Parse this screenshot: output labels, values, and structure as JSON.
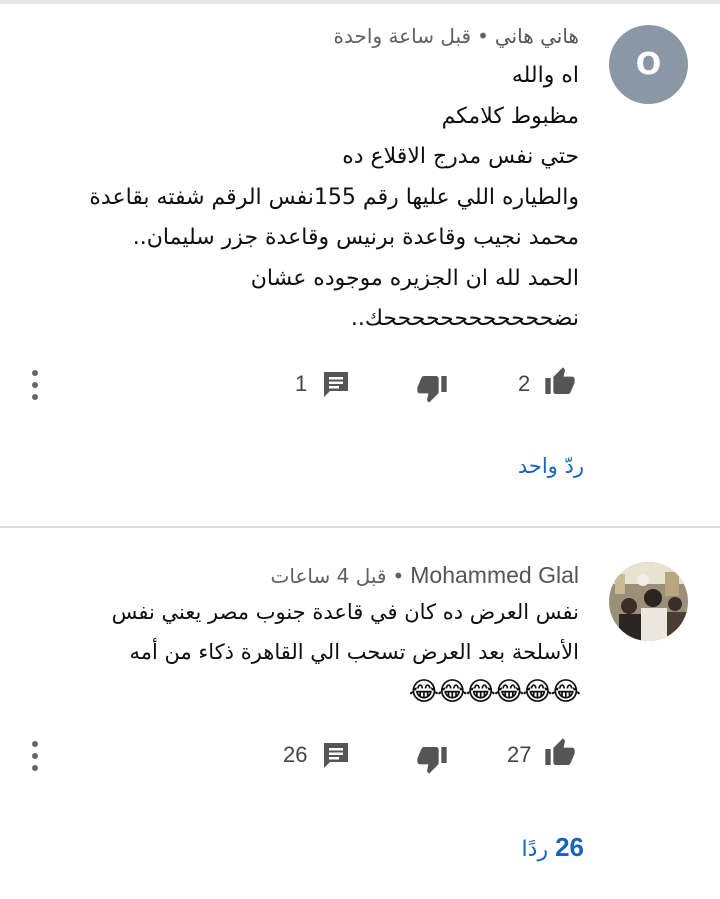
{
  "comments": [
    {
      "author": "هاني هاني",
      "time": "قبل ساعة واحدة",
      "avatar_letter": "O",
      "lines": [
        "اه والله",
        "مظبوط كلامكم",
        "حتي نفس مدرج الاقلاع ده",
        "والطياره اللي عليها رقم 155نفس الرقم شفته بقاعدة",
        "محمد نجيب وقاعدة برنيس وقاعدة جزر سليمان..",
        "الحمد لله ان الجزيره موجوده عشان",
        "نضححححححححححححك.."
      ],
      "likes": "2",
      "replies_count": "1",
      "reply_link": "ردّ واحد"
    },
    {
      "author": "Mohammed Glal",
      "time": "قبل 4 ساعات",
      "lines": [
        "نفس العرض ده كان في قاعدة جنوب مصر يعني نفس",
        "الأسلحة بعد العرض تسحب الي القاهرة ذكاء من أمه",
        "😂😂😂😂😂😂"
      ],
      "likes": "27",
      "replies_count": "26",
      "reply_count_num": "26",
      "reply_link_word": "ردًا"
    }
  ],
  "icons": {
    "like": "thumb-up-icon",
    "dislike": "thumb-down-icon",
    "reply": "comment-icon",
    "more": "more-vert-icon"
  },
  "colors": {
    "link": "#1565c0",
    "meta": "#606060",
    "avatar_bg": "#8a98a6"
  }
}
